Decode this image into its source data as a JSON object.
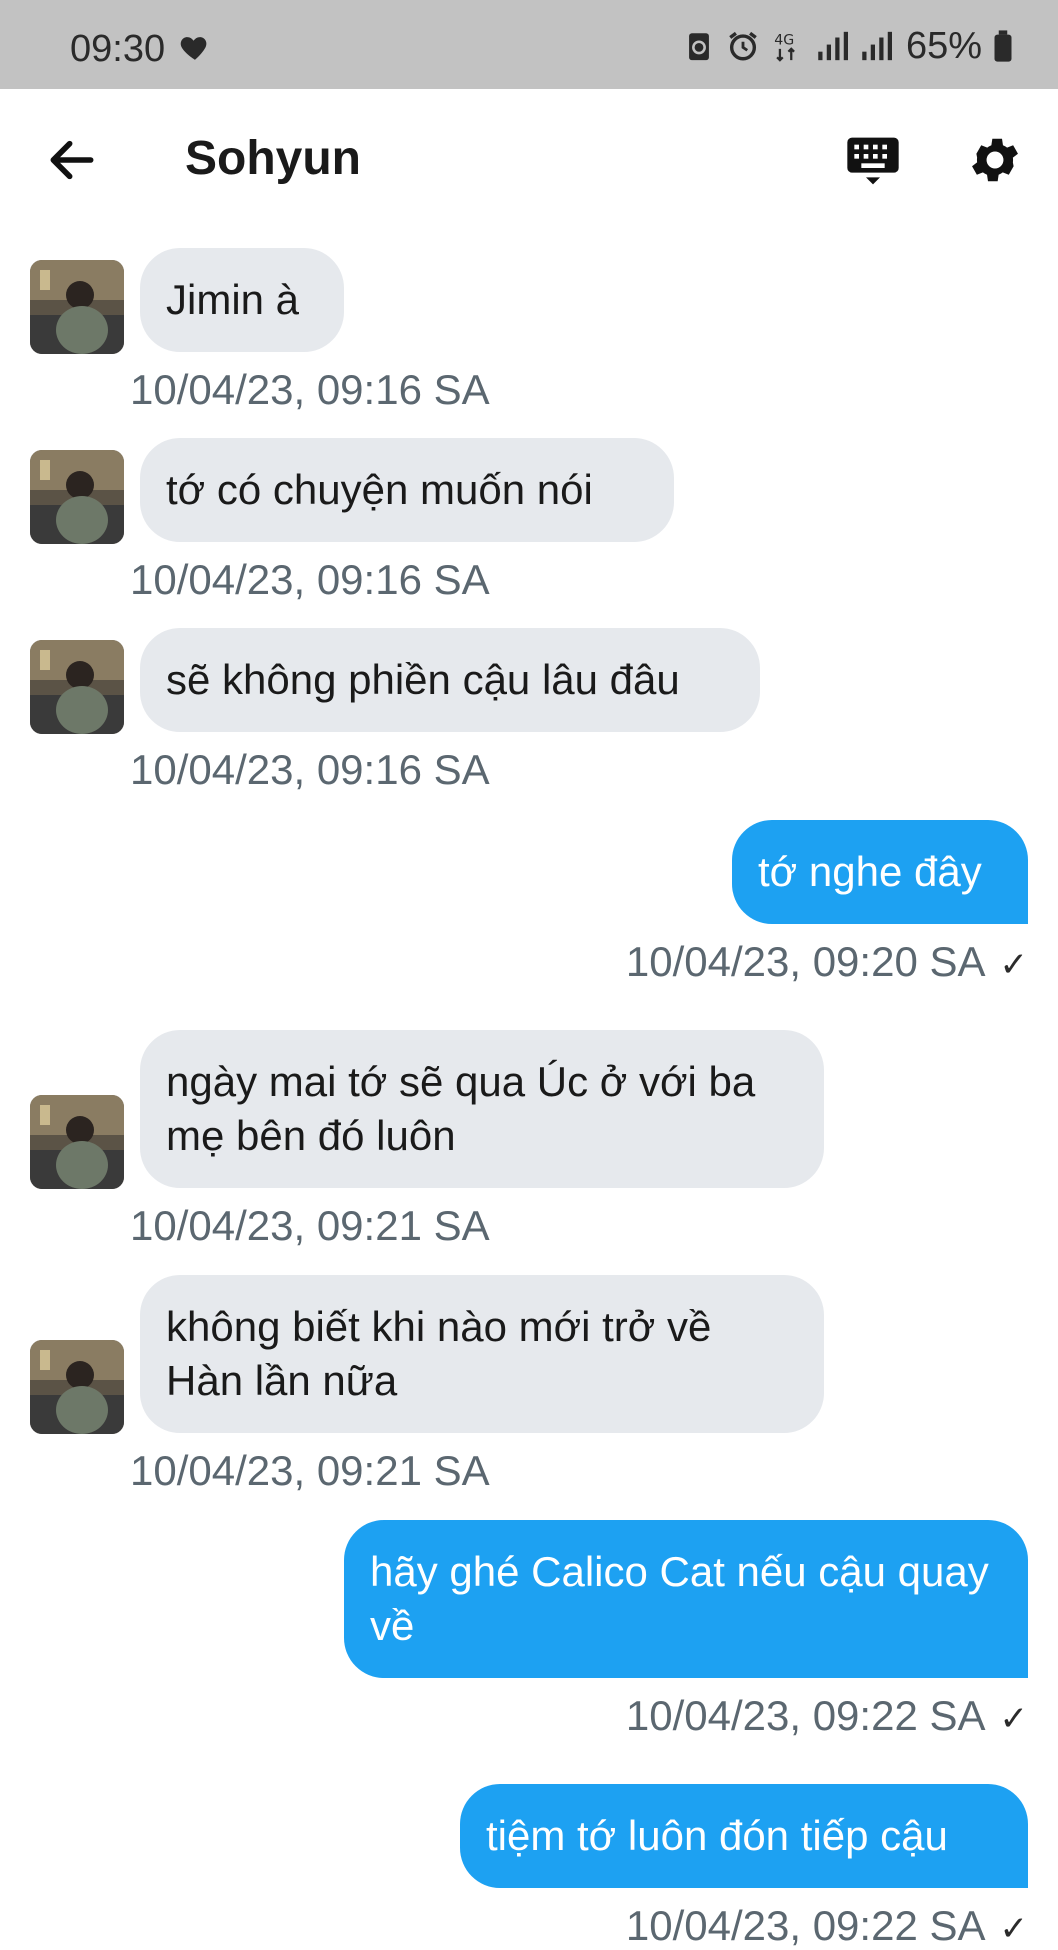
{
  "status_bar": {
    "time": "09:30",
    "battery": "65%",
    "network": "4G"
  },
  "header": {
    "title": "Sohyun"
  },
  "messages": [
    {
      "side": "in",
      "text": "Jimin à",
      "timestamp": "10/04/23, 09:16 SA"
    },
    {
      "side": "in",
      "text": "tớ có chuyện muốn nói",
      "timestamp": "10/04/23, 09:16 SA"
    },
    {
      "side": "in",
      "text": "sẽ không phiền cậu lâu đâu",
      "timestamp": "10/04/23, 09:16 SA"
    },
    {
      "side": "out",
      "text": "tớ nghe đây",
      "timestamp": "10/04/23, 09:20 SA",
      "status": "✓"
    },
    {
      "side": "in",
      "text": "ngày mai tớ sẽ qua Úc ở với ba mẹ bên đó luôn",
      "timestamp": "10/04/23, 09:21 SA"
    },
    {
      "side": "in",
      "text": "không biết khi nào mới trở về Hàn lần nữa",
      "timestamp": "10/04/23, 09:21 SA"
    },
    {
      "side": "out",
      "text": "hãy ghé Calico Cat nếu cậu quay về",
      "timestamp": "10/04/23, 09:22 SA",
      "status": "✓"
    },
    {
      "side": "out",
      "text": "tiệm tớ luôn đón tiếp cậu",
      "timestamp": "10/04/23, 09:22 SA",
      "status": "✓"
    }
  ],
  "colors": {
    "outgoing_bubble": "#1da1f2",
    "incoming_bubble": "#e6e9ed",
    "timestamp": "#5b6770",
    "status_bar": "#c2c2c2"
  }
}
